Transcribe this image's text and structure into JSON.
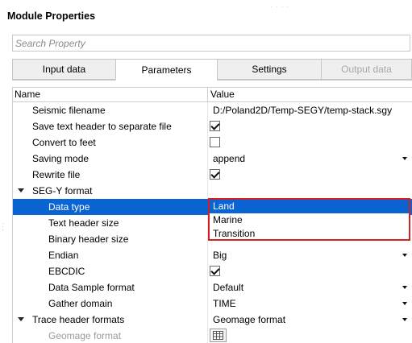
{
  "panel": {
    "title": "Module Properties"
  },
  "search": {
    "placeholder": "Search Property"
  },
  "tabs": [
    {
      "label": "Input data",
      "state": "normal"
    },
    {
      "label": "Parameters",
      "state": "active"
    },
    {
      "label": "Settings",
      "state": "normal"
    },
    {
      "label": "Output data",
      "state": "disabled"
    }
  ],
  "grid": {
    "header": {
      "name": "Name",
      "value": "Value"
    },
    "rows": {
      "seismic_filename": {
        "name": "Seismic filename",
        "value": "D:/Poland2D/Temp-SEGY/temp-stack.sgy"
      },
      "save_text_header": {
        "name": "Save text header to separate file",
        "checked": true
      },
      "convert_to_feet": {
        "name": "Convert to feet",
        "checked": false
      },
      "saving_mode": {
        "name": "Saving mode",
        "value": "append"
      },
      "rewrite_file": {
        "name": "Rewrite file",
        "checked": true
      },
      "segy_format": {
        "name": "SEG-Y format",
        "expanded": true
      },
      "data_type": {
        "name": "Data type",
        "value": "Land"
      },
      "text_header_size": {
        "name": "Text header size"
      },
      "binary_header_size": {
        "name": "Binary header size"
      },
      "endian": {
        "name": "Endian",
        "value": "Big"
      },
      "ebcdic": {
        "name": "EBCDIC",
        "checked": true
      },
      "data_sample_format": {
        "name": "Data Sample format",
        "value": "Default"
      },
      "gather_domain": {
        "name": "Gather domain",
        "value": "TIME"
      },
      "trace_header_formats": {
        "name": "Trace header formats",
        "value": "Geomage format",
        "expanded": true
      },
      "geomage_format": {
        "name": "Geomage format",
        "icon": "table-icon"
      }
    }
  },
  "dropdown": {
    "options": [
      "Land",
      "Marine",
      "Transition"
    ],
    "highlighted": "Land",
    "highlight_border_color": "#d42020"
  },
  "colors": {
    "selection": "#0a64d2"
  }
}
